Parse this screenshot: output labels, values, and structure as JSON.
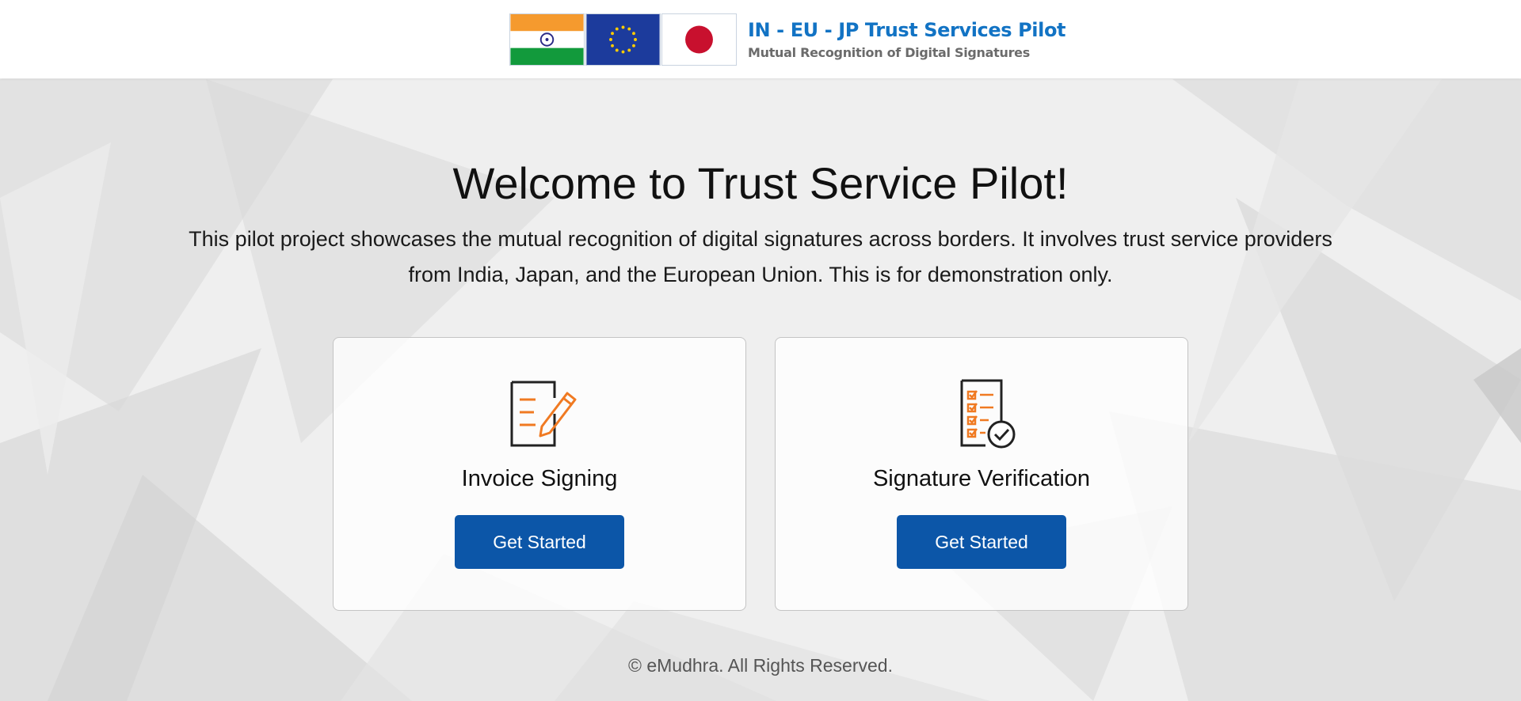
{
  "header": {
    "title": "IN - EU - JP Trust Services Pilot",
    "subtitle": "Mutual Recognition of Digital Signatures",
    "flags": [
      "india-flag-icon",
      "eu-flag-icon",
      "japan-flag-icon"
    ]
  },
  "hero": {
    "title": "Welcome to Trust Service Pilot!",
    "description": "This pilot project showcases the mutual recognition of digital signatures across borders. It involves trust service providers from India, Japan, and the European Union. This is for demonstration only."
  },
  "cards": [
    {
      "title": "Invoice Signing",
      "button": "Get Started",
      "icon": "document-pen-icon"
    },
    {
      "title": "Signature Verification",
      "button": "Get Started",
      "icon": "checklist-verified-icon"
    }
  ],
  "footer": {
    "text": "© eMudhra. All Rights Reserved."
  },
  "colors": {
    "brand_blue": "#1273c4",
    "button_blue": "#0c56a8",
    "accent_orange": "#f07a22",
    "subtitle_gray": "#6b6b6b"
  }
}
